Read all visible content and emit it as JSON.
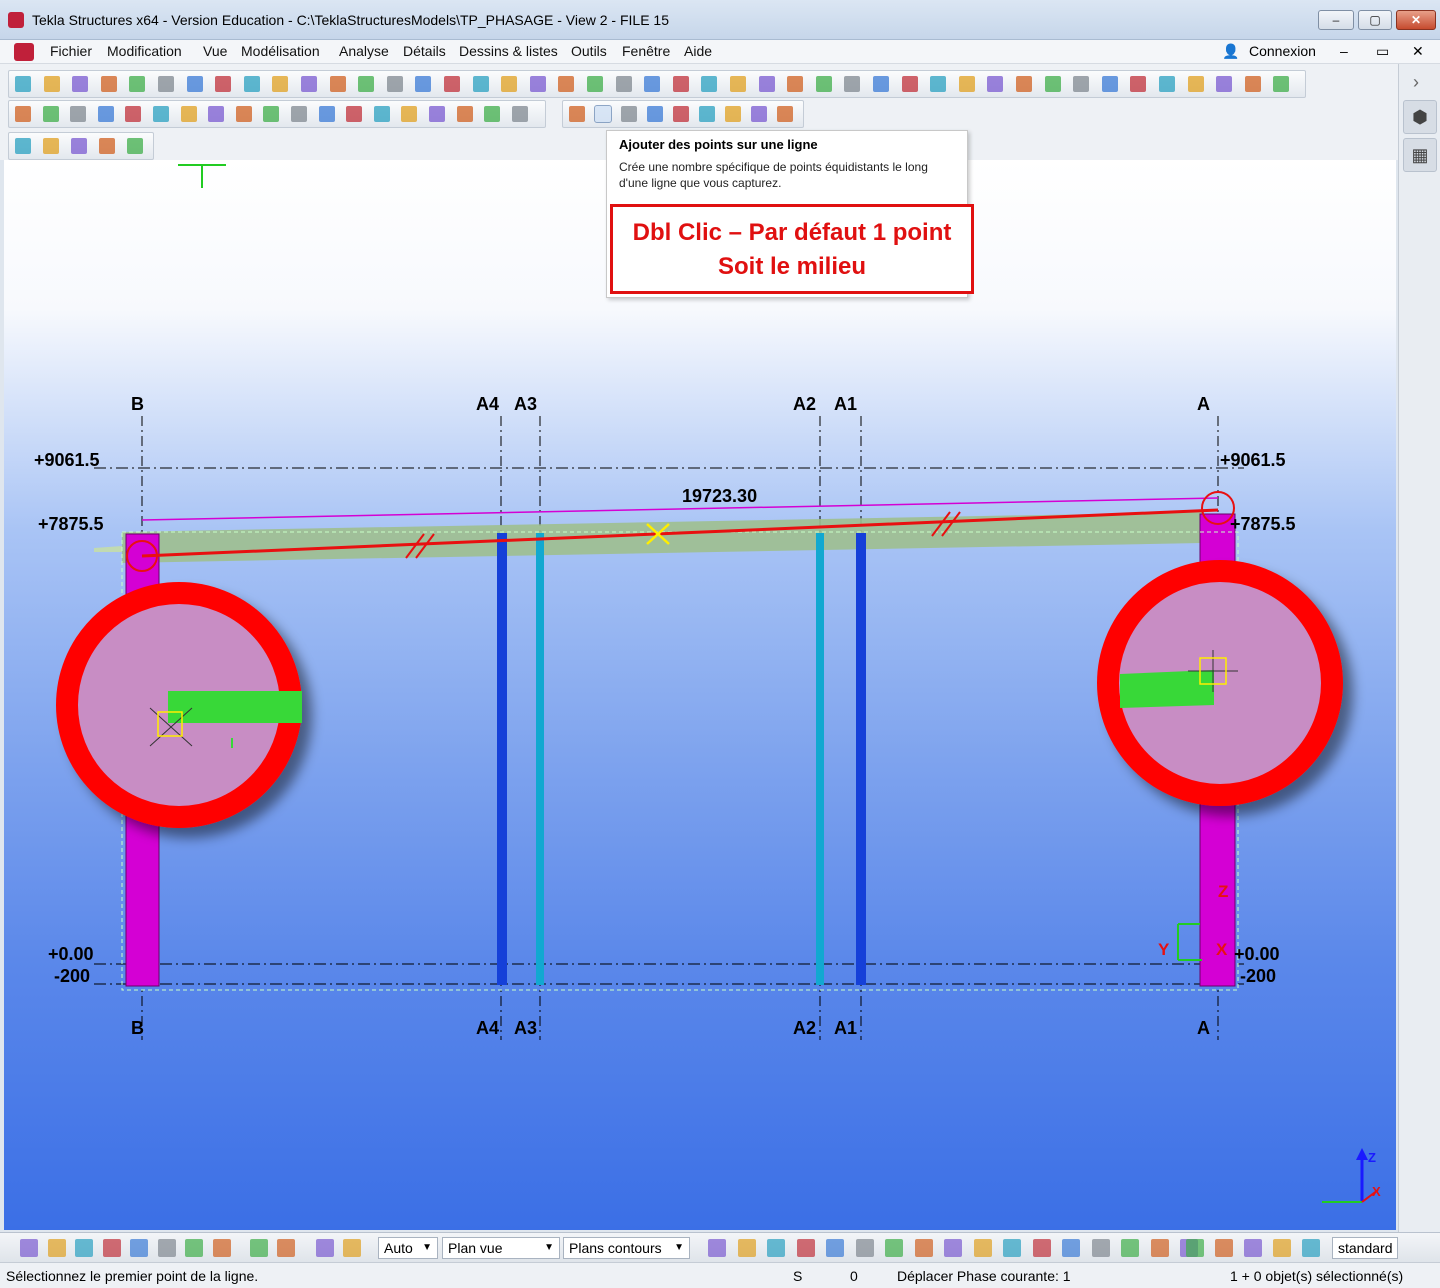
{
  "window": {
    "title": "Tekla Structures x64 - Version Education - C:\\TeklaStructuresModels\\TP_PHASAGE  - View 2 - FILE 15",
    "minimize": "–",
    "restore": "▢",
    "close": "✕"
  },
  "menu": {
    "items": [
      "Fichier",
      "Modification",
      "Vue",
      "Modélisation",
      "Analyse",
      "Détails",
      "Dessins & listes",
      "Outils",
      "Fenêtre",
      "Aide"
    ],
    "connexion": "Connexion"
  },
  "tooltip": {
    "title": "Ajouter des points sur une ligne",
    "body": "Crée une nombre spécifique de points équidistants le long d'une ligne que vous capturez."
  },
  "callout": {
    "line1": "Dbl Clic – Par défaut 1 point",
    "line2": "Soit le milieu"
  },
  "view": {
    "grid_labels_top": [
      "B",
      "A4",
      "A3",
      "A2",
      "A1",
      "A"
    ],
    "grid_labels_bottom": [
      "B",
      "A4",
      "A3",
      "A2",
      "A1",
      "A"
    ],
    "levels_left": [
      "+9061.5",
      "+7875.5",
      "+0.00",
      "-200"
    ],
    "levels_right": [
      "+9061.5",
      "+7875.5",
      "+0.00",
      "-200"
    ],
    "dimension": "19723.30",
    "axis_z": "Z",
    "axis_y": "Y",
    "axis_x": "X",
    "colors": {
      "column": "#d400d4",
      "beam": "#9fbf8f",
      "red_line": "#e81010",
      "blue_post": "#1540d8",
      "cyan_post": "#12a8d0",
      "circle_fill": "#c88dc4",
      "green": "#38d838"
    }
  },
  "bottom": {
    "combo1": "Auto",
    "combo2": "Plan vue",
    "combo3": "Plans contours",
    "combo4": "standard"
  },
  "status": {
    "message": "Sélectionnez le premier point de la ligne.",
    "s": "S",
    "zero": "0",
    "phase": "Déplacer Phase courante: 1",
    "selection": "1 + 0 objet(s) sélectionné(s)"
  }
}
